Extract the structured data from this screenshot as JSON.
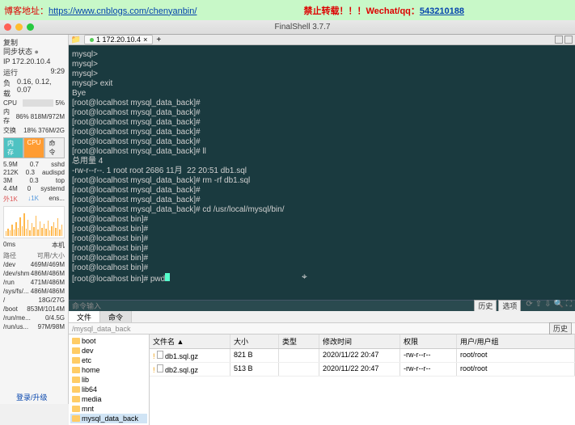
{
  "banner": {
    "label": "博客地址：",
    "url": "https://www.cnblogs.com/chenyanbin/",
    "center": "禁止转载！！！",
    "wechat_label": "Wechat/qq：",
    "wechat": "543210188"
  },
  "title": "FinalShell 3.7.7",
  "sidebar": {
    "copy": "复制",
    "sync": "同步状态",
    "ip": "IP 172.20.10.4",
    "uptime_lbl": "运行",
    "uptime": "9:29",
    "load_lbl": "负载",
    "load": "0.16, 0.12, 0.07",
    "cpu": {
      "lbl": "CPU",
      "pct": "5%"
    },
    "mem": {
      "lbl": "内存",
      "pct": "86%",
      "val": "818M/972M"
    },
    "swap": {
      "lbl": "交换",
      "pct": "18%",
      "val": "376M/2G"
    },
    "tabs": {
      "mem": "内存",
      "cpu": "CPU",
      "cmd": "命令"
    },
    "procs": [
      [
        "5.9M",
        "0.7",
        "sshd"
      ],
      [
        "212K",
        "0.3",
        "audispd"
      ],
      [
        "3M",
        "0.3",
        "top"
      ],
      [
        "4.4M",
        "0",
        "systemd"
      ]
    ],
    "net": {
      "up": "外1K",
      "down": "↓1K",
      "iface": "ens...",
      "time": "0ms",
      "host": "本机"
    },
    "disk_hdr": {
      "path": "路径",
      "avail": "可用/大小"
    },
    "disks": [
      [
        "/dev",
        "469M/469M"
      ],
      [
        "/dev/shm",
        "486M/486M"
      ],
      [
        "/run",
        "471M/486M"
      ],
      [
        "/sys/fs/...",
        "486M/486M"
      ],
      [
        "/",
        "18G/27G"
      ],
      [
        "/boot",
        "853M/1014M"
      ],
      [
        "/run/me...",
        "0/4.5G"
      ],
      [
        "/run/us...",
        "97M/98M"
      ]
    ],
    "upgrade": "登录/升级"
  },
  "tab": {
    "host": "1 172.20.10.4"
  },
  "terminal": [
    "mysql>",
    "mysql>",
    "mysql>",
    "mysql> exit",
    "Bye",
    "[root@localhost mysql_data_back]#",
    "[root@localhost mysql_data_back]#",
    "[root@localhost mysql_data_back]#",
    "[root@localhost mysql_data_back]#",
    "[root@localhost mysql_data_back]#",
    "[root@localhost mysql_data_back]# ll",
    "总用量 4",
    "-rw-r--r--. 1 root root 2686 11月  22 20:51 db1.sql",
    "[root@localhost mysql_data_back]# rm -rf db1.sql",
    "[root@localhost mysql_data_back]#",
    "[root@localhost mysql_data_back]#",
    "[root@localhost mysql_data_back]# cd /usr/local/mysql/bin/",
    "[root@localhost bin]#",
    "[root@localhost bin]#",
    "[root@localhost bin]#",
    "[root@localhost bin]#",
    "[root@localhost bin]#",
    "[root@localhost bin]#"
  ],
  "terminal_input": "[root@localhost bin]# pwd",
  "cmd_placeholder": "命令输入",
  "buttons": {
    "history": "历史",
    "options": "选项"
  },
  "file_tabs": {
    "file": "文件",
    "cmd": "命令"
  },
  "path": "/mysql_data_back",
  "cols": {
    "name": "文件名 ▲",
    "size": "大小",
    "type": "类型",
    "date": "修改时间",
    "perm": "权限",
    "own": "用户/用户组"
  },
  "tree": [
    "boot",
    "dev",
    "etc",
    "home",
    "lib",
    "lib64",
    "media",
    "mnt",
    "mysql_data_back"
  ],
  "files": [
    {
      "name": "db1.sql.gz",
      "size": "821 B",
      "type": "",
      "date": "2020/11/22 20:47",
      "perm": "-rw-r--r--",
      "own": "root/root"
    },
    {
      "name": "db2.sql.gz",
      "size": "513 B",
      "type": "",
      "date": "2020/11/22 20:47",
      "perm": "-rw-r--r--",
      "own": "root/root"
    }
  ],
  "chart_data": {
    "type": "bar",
    "title": "network",
    "values": [
      5,
      8,
      6,
      12,
      7,
      15,
      9,
      20,
      11,
      25,
      8,
      18,
      6,
      14,
      10,
      22,
      7,
      16,
      9,
      13,
      8,
      17,
      6,
      11,
      15,
      9,
      19,
      7,
      12
    ],
    "ylim": [
      0,
      30
    ]
  }
}
